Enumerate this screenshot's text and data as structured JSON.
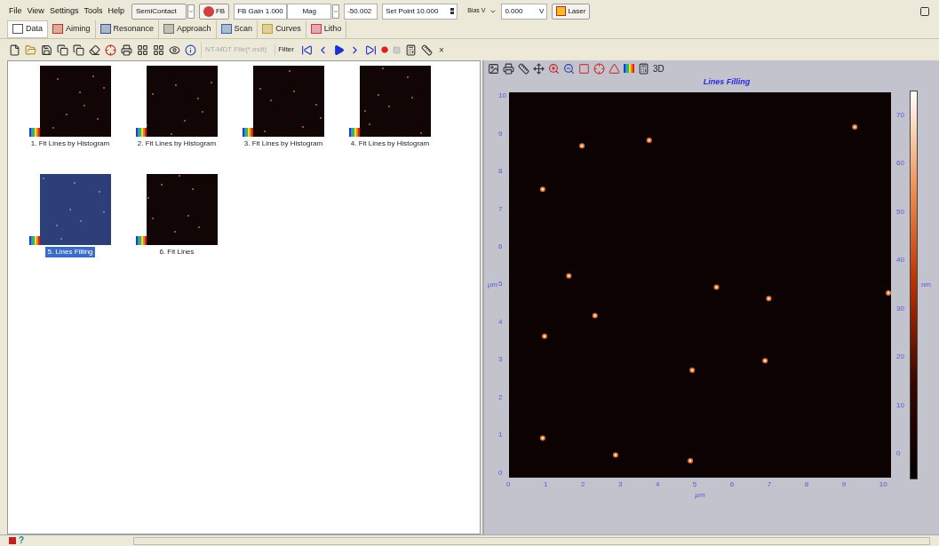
{
  "menu": [
    "File",
    "View",
    "Settings",
    "Tools",
    "Help"
  ],
  "mode_select": {
    "value": "SemiContact"
  },
  "fb_button": {
    "label": "FB"
  },
  "fb_gain": {
    "value": "FB Gain 1.000"
  },
  "mag_select": {
    "value": "Mag"
  },
  "offset_field": {
    "value": "-50.002"
  },
  "set_point": {
    "value": "Set Point 10.000"
  },
  "bias": {
    "label": "Bias V",
    "value": "0.000",
    "unit": "V"
  },
  "laser_button": {
    "label": "Laser"
  },
  "tabs": [
    {
      "label": "Data",
      "selected": true
    },
    {
      "label": "Aiming",
      "selected": false
    },
    {
      "label": "Resonance",
      "selected": false
    },
    {
      "label": "Approach",
      "selected": false
    },
    {
      "label": "Scan",
      "selected": false
    },
    {
      "label": "Curves",
      "selected": false
    },
    {
      "label": "Litho",
      "selected": false
    }
  ],
  "toolbar": {
    "file_type": {
      "value": "NT-MDT File(*.mdt)",
      "disabled": true
    },
    "filter": {
      "label": "Filter"
    },
    "close": "×"
  },
  "thumbnails": [
    {
      "label": "1. Fit Lines by Histogram",
      "selected": false
    },
    {
      "label": "2. Fit Lines by Histogram",
      "selected": false
    },
    {
      "label": "3. Fit Lines by Histogram",
      "selected": false
    },
    {
      "label": "4. Fit Lines by Histogram",
      "selected": false
    },
    {
      "label": "5. Lines Filling",
      "selected": true
    },
    {
      "label": "6. Fit Lines",
      "selected": false
    }
  ],
  "viewer": {
    "view_3d": "3D",
    "title": "Lines Filling",
    "x_axis": {
      "label": "µm",
      "ticks": [
        "0",
        "1",
        "2",
        "3",
        "4",
        "5",
        "6",
        "7",
        "8",
        "9",
        "10"
      ]
    },
    "y_axis": {
      "label": "µm",
      "ticks": [
        "10",
        "9",
        "8",
        "7",
        "6",
        "5",
        "4",
        "3",
        "2",
        "1",
        "0"
      ]
    },
    "colorbar": {
      "unit": "nm",
      "ticks": [
        "70",
        "60",
        "50",
        "40",
        "30",
        "20",
        "10",
        "0"
      ]
    }
  },
  "status_bar": {
    "help": "?"
  }
}
